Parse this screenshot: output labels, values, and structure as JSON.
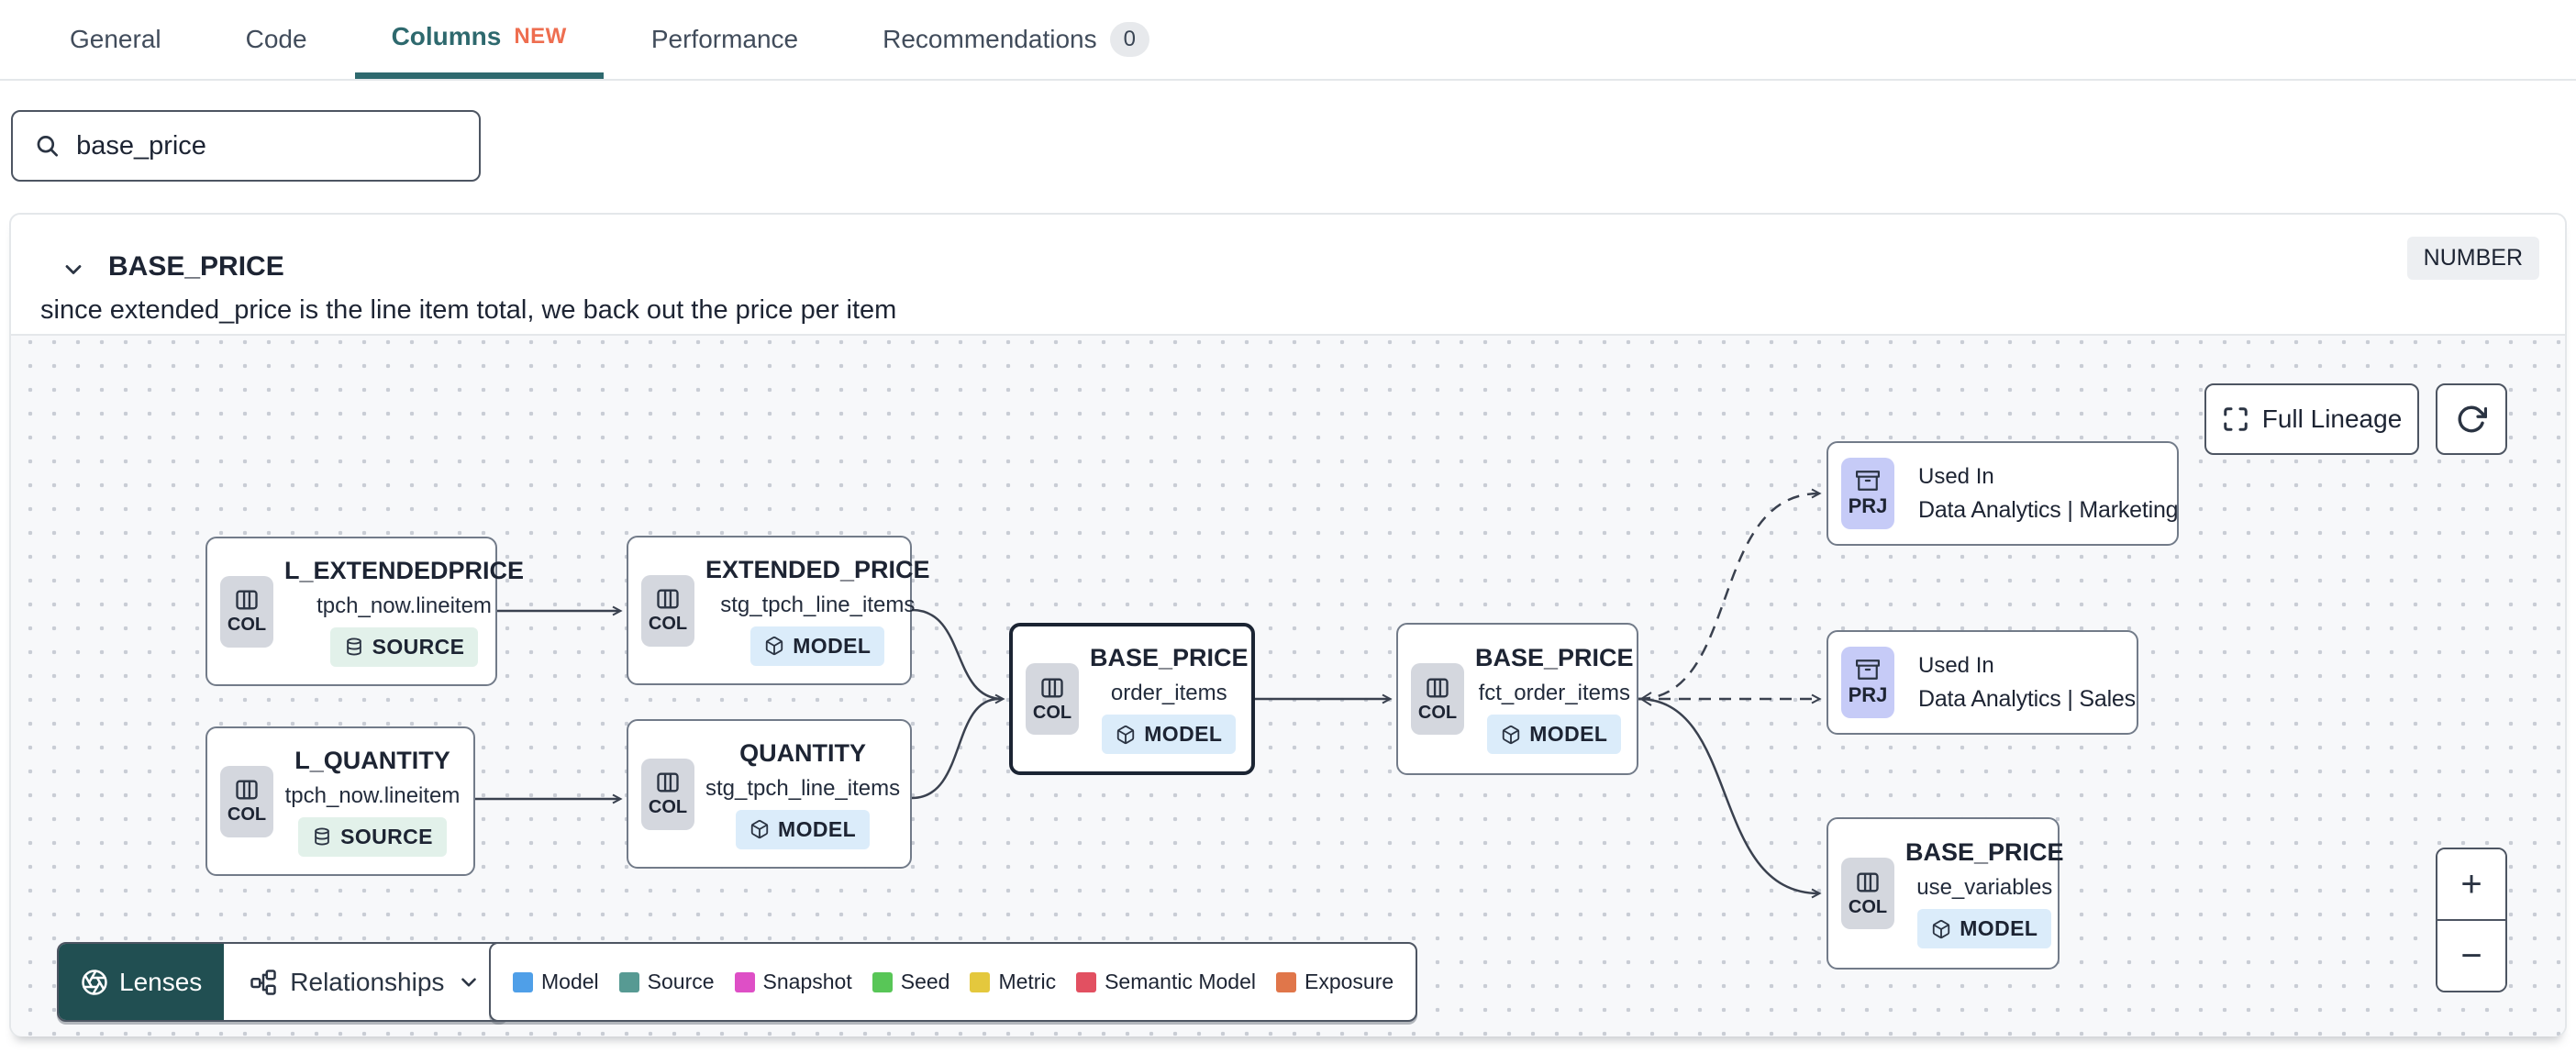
{
  "tabs": {
    "items": [
      {
        "label": "General"
      },
      {
        "label": "Code"
      },
      {
        "label": "Columns",
        "badge": "NEW"
      },
      {
        "label": "Performance"
      },
      {
        "label": "Recommendations",
        "count": "0"
      }
    ]
  },
  "search": {
    "value": "base_price"
  },
  "column_panel": {
    "name": "BASE_PRICE",
    "type_badge": "NUMBER",
    "description": "since extended_price is the line item total, we back out the price per item"
  },
  "lineage": {
    "controls": {
      "full_lineage_label": "Full Lineage",
      "zoom_in": "+",
      "zoom_out": "−"
    },
    "toolbar": {
      "lenses_label": "Lenses",
      "relationships_label": "Relationships"
    },
    "nodes": [
      {
        "title": "L_EXTENDEDPRICE",
        "subtitle": "tpch_now.lineitem",
        "entity": "COL",
        "badge": "SOURCE"
      },
      {
        "title": "EXTENDED_PRICE",
        "subtitle": "stg_tpch_line_items",
        "entity": "COL",
        "badge": "MODEL"
      },
      {
        "title": "L_QUANTITY",
        "subtitle": "tpch_now.lineitem",
        "entity": "COL",
        "badge": "SOURCE"
      },
      {
        "title": "QUANTITY",
        "subtitle": "stg_tpch_line_items",
        "entity": "COL",
        "badge": "MODEL"
      },
      {
        "title": "BASE_PRICE",
        "subtitle": "order_items",
        "entity": "COL",
        "badge": "MODEL",
        "selected": true
      },
      {
        "title": "BASE_PRICE",
        "subtitle": "fct_order_items",
        "entity": "COL",
        "badge": "MODEL"
      },
      {
        "kicker": "Used In",
        "title": "Data Analytics | Marketing",
        "entity": "PRJ"
      },
      {
        "kicker": "Used In",
        "title": "Data Analytics | Sales",
        "entity": "PRJ"
      },
      {
        "title": "BASE_PRICE",
        "subtitle": "use_variables",
        "entity": "COL",
        "badge": "MODEL"
      }
    ],
    "legend": [
      {
        "label": "Model",
        "color": "#4f9fe8"
      },
      {
        "label": "Source",
        "color": "#579a93"
      },
      {
        "label": "Snapshot",
        "color": "#de4fc6"
      },
      {
        "label": "Seed",
        "color": "#58c657"
      },
      {
        "label": "Metric",
        "color": "#e4c83d"
      },
      {
        "label": "Semantic Model",
        "color": "#e25061"
      },
      {
        "label": "Exposure",
        "color": "#e0764a"
      }
    ],
    "colors": {
      "accent_teal": "#2e696e",
      "new_badge": "#ee6e50",
      "edge": "#3a414f"
    }
  }
}
